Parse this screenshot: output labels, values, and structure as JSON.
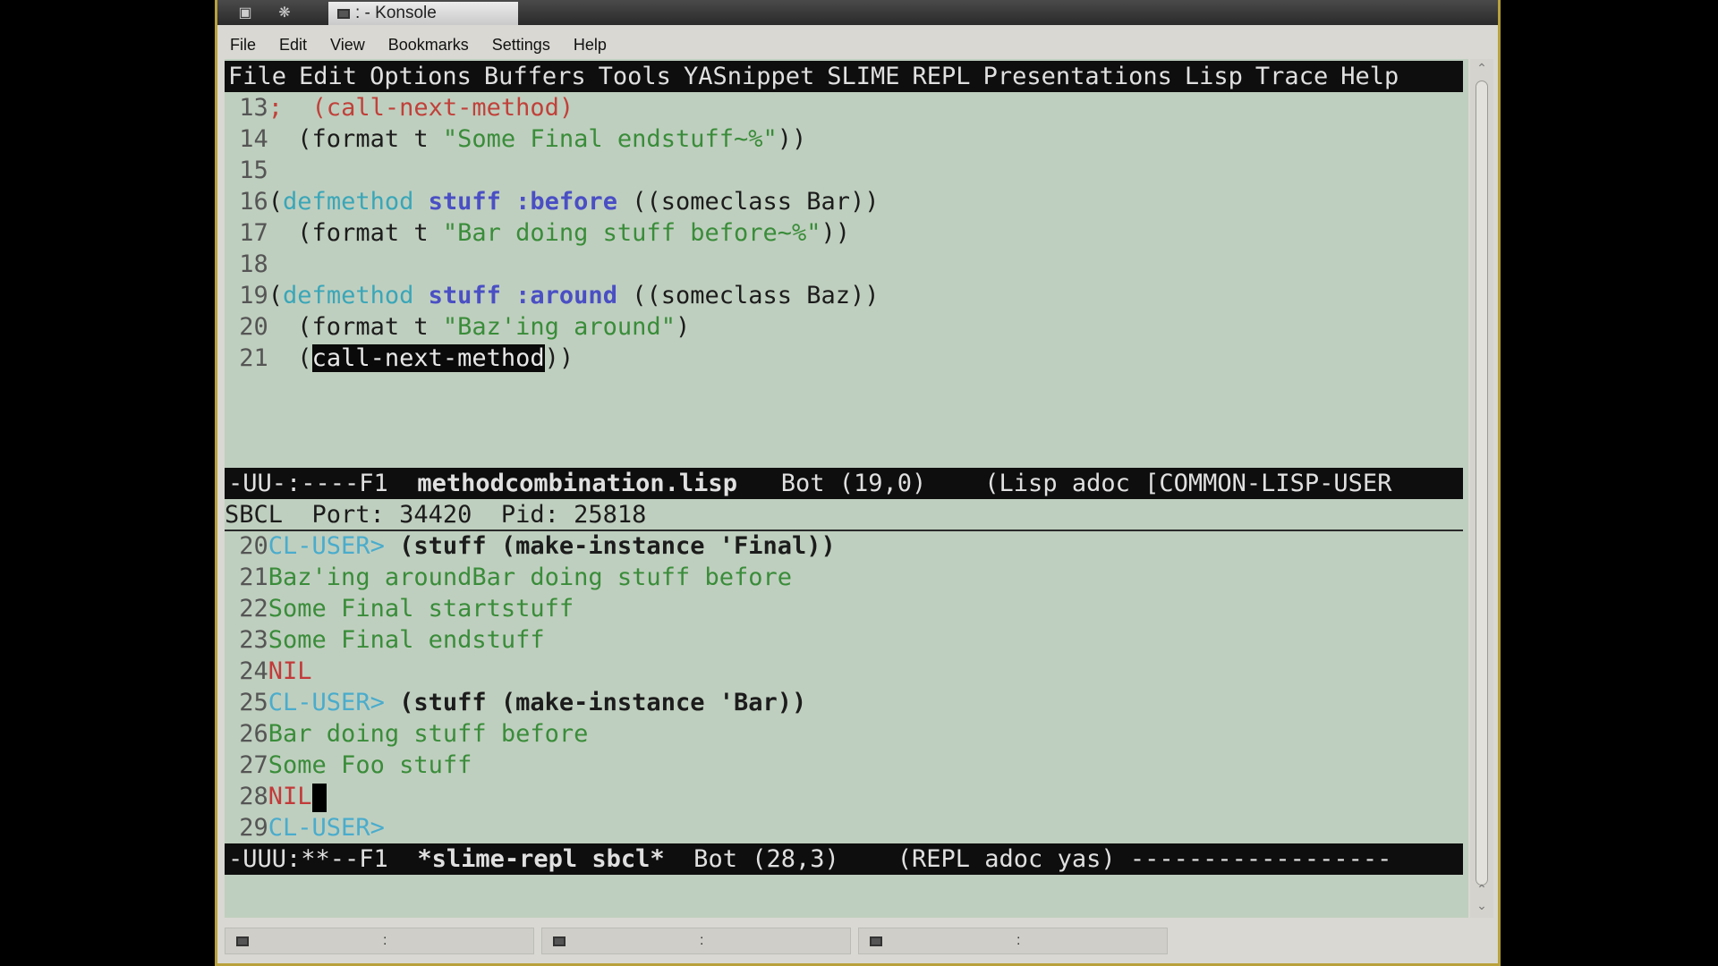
{
  "window": {
    "title": ": - Konsole"
  },
  "konsole_menu": [
    "File",
    "Edit",
    "View",
    "Bookmarks",
    "Settings",
    "Help"
  ],
  "emacs_menu": [
    "File",
    "Edit",
    "Options",
    "Buffers",
    "Tools",
    "YASnippet",
    "SLIME",
    "REPL",
    "Presentations",
    "Lisp",
    "Trace",
    "Help"
  ],
  "editor": {
    "lines": [
      {
        "n": "13",
        "pre": "; ",
        "comment": " (call-next-method)"
      },
      {
        "n": "14",
        "text": "  (format t ",
        "str": "\"Some Final endstuff~%\"",
        "post": "))"
      },
      {
        "n": "15"
      },
      {
        "n": "16",
        "open": "(",
        "kw": "defmethod",
        "fn": "stuff :before",
        "post": " ((someclass Bar))"
      },
      {
        "n": "17",
        "text": "  (format t ",
        "str": "\"Bar doing stuff before~%\"",
        "post": "))"
      },
      {
        "n": "18"
      },
      {
        "n": "19",
        "open": "(",
        "kw": "defmethod",
        "fn": "stuff :around",
        "post": " ((someclass Baz))"
      },
      {
        "n": "20",
        "text": "  (format t ",
        "str": "\"Baz'ing around\"",
        "post": ")"
      },
      {
        "n": "21",
        "text": "  (",
        "hl": "call-next-method",
        "post": "))"
      }
    ],
    "modeline": {
      "prefix": "-UU-:----F1  ",
      "buffer": "methodcombination.lisp",
      "rest": "   Bot (19,0)    (Lisp adoc [COMMON-LISP-USER"
    }
  },
  "repl": {
    "header": "SBCL  Port: 34420  Pid: 25818",
    "lines": [
      {
        "n": "20",
        "prompt": "CL-USER> ",
        "input": "(stuff (make-instance 'Final))"
      },
      {
        "n": "21",
        "out": "Baz'ing aroundBar doing stuff before"
      },
      {
        "n": "22",
        "out": "Some Final startstuff"
      },
      {
        "n": "23",
        "out": "Some Final endstuff"
      },
      {
        "n": "24",
        "nil": "NIL"
      },
      {
        "n": "25",
        "prompt": "CL-USER> ",
        "input": "(stuff (make-instance 'Bar))"
      },
      {
        "n": "26",
        "out": "Bar doing stuff before"
      },
      {
        "n": "27",
        "out": "Some Foo stuff"
      },
      {
        "n": "28",
        "nil": "NIL"
      },
      {
        "n": "29",
        "prompt": "CL-USER>"
      }
    ],
    "modeline": {
      "prefix": "-UUU:**--F1  ",
      "buffer": "*slime-repl sbcl*",
      "rest": "  Bot (28,3)    (REPL adoc yas) ------------------"
    }
  },
  "session_tabs": [
    ":",
    ":",
    ":"
  ]
}
